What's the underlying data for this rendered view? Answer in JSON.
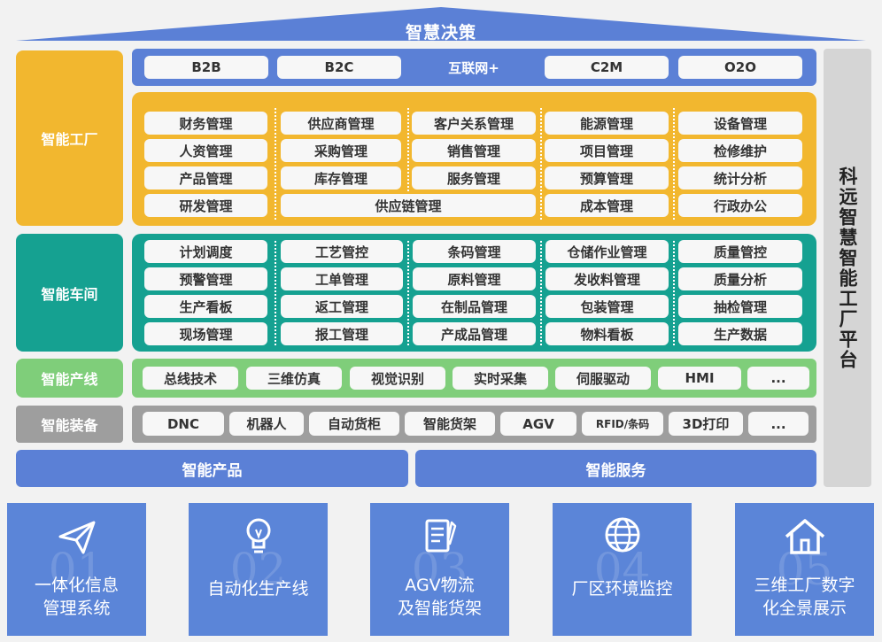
{
  "roof": {
    "title": "智慧决策"
  },
  "layers": {
    "factory": "智能工厂",
    "workshop": "智能车间",
    "line": "智能产线",
    "equipment": "智能装备"
  },
  "internet": [
    "B2B",
    "B2C",
    "互联网+",
    "C2M",
    "O2O"
  ],
  "factory_grid": [
    [
      "财务管理",
      "供应商管理",
      "客户关系管理",
      "能源管理",
      "设备管理"
    ],
    [
      "人资管理",
      "采购管理",
      "销售管理",
      "项目管理",
      "检修维护"
    ],
    [
      "产品管理",
      "库存管理",
      "服务管理",
      "预算管理",
      "统计分析"
    ],
    [
      "研发管理",
      "供应链管理",
      "成本管理",
      "行政办公"
    ]
  ],
  "workshop_grid": [
    [
      "计划调度",
      "工艺管控",
      "条码管理",
      "仓储作业管理",
      "质量管控"
    ],
    [
      "预警管理",
      "工单管理",
      "原料管理",
      "发收料管理",
      "质量分析"
    ],
    [
      "生产看板",
      "返工管理",
      "在制品管理",
      "包装管理",
      "抽检管理"
    ],
    [
      "现场管理",
      "报工管理",
      "产成品管理",
      "物料看板",
      "生产数据"
    ]
  ],
  "line_items": [
    "总线技术",
    "三维仿真",
    "视觉识别",
    "实时采集",
    "伺服驱动",
    "HMI",
    "..."
  ],
  "equipment_items": [
    "DNC",
    "机器人",
    "自动货柜",
    "智能货架",
    "AGV",
    "RFID/条码",
    "3D打印",
    "..."
  ],
  "side_title": "科远智慧智能工厂平台",
  "bottom": {
    "product": "智能产品",
    "service": "智能服务"
  },
  "cards": [
    {
      "num": "01",
      "icon": "paper-plane-icon",
      "text": "一体化信息\n管理系统"
    },
    {
      "num": "02",
      "icon": "lightbulb-icon",
      "text": "自动化生产线"
    },
    {
      "num": "03",
      "icon": "document-pen-icon",
      "text": "AGV物流\n及智能货架"
    },
    {
      "num": "04",
      "icon": "globe-icon",
      "text": "厂区环境监控"
    },
    {
      "num": "05",
      "icon": "home-icon",
      "text": "三维工厂数字\n化全景展示"
    }
  ],
  "colors": {
    "blue": "#5b80d6",
    "yellow": "#f2b72f",
    "teal": "#15a191",
    "green": "#7fce7a",
    "gray": "#9e9e9e",
    "side_gray": "#d5d5d5"
  }
}
